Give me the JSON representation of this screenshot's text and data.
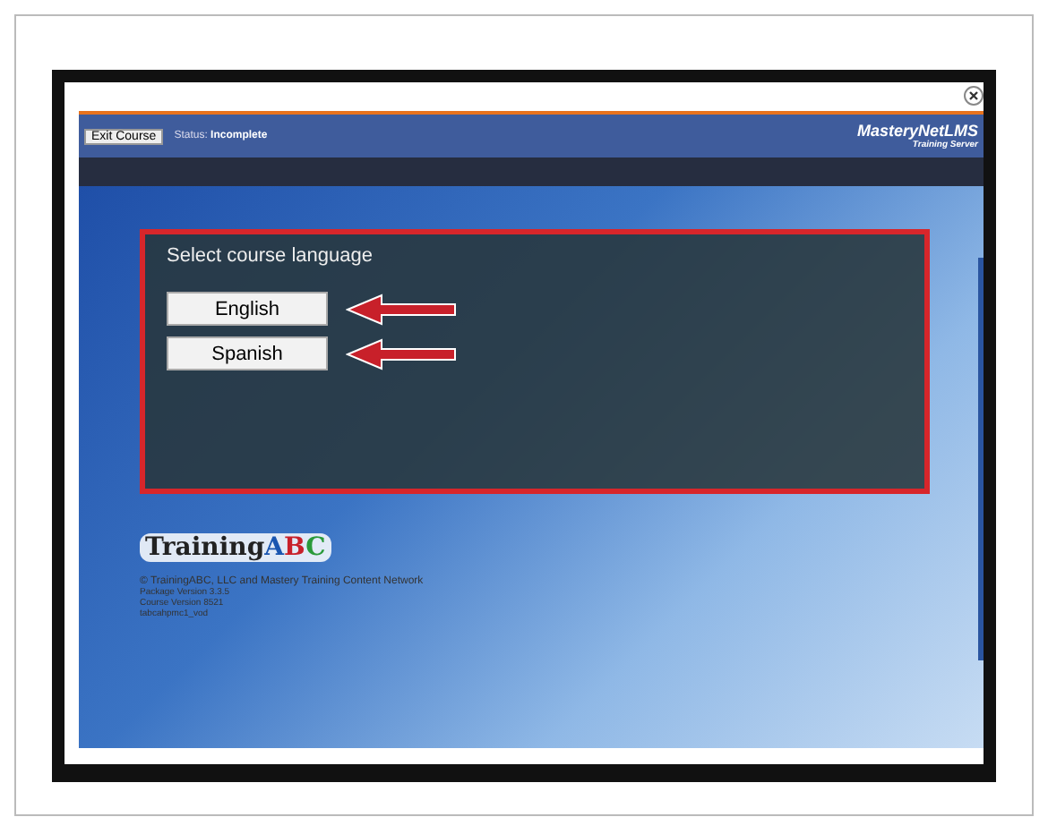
{
  "header": {
    "exit_button": "Exit Course",
    "status_label": "Status:",
    "status_value": "Incomplete",
    "brand_line1": "MasteryNetLMS",
    "brand_line2": "Training Server"
  },
  "dialog": {
    "title": "Select course language",
    "options": [
      {
        "label": "English",
        "pointed": true
      },
      {
        "label": "Spanish",
        "pointed": true
      }
    ]
  },
  "footer": {
    "logo_text": "Training",
    "logo_letters": [
      {
        "letter": "A",
        "color": "#1a56b0"
      },
      {
        "letter": "B",
        "color": "#c8202a"
      },
      {
        "letter": "C",
        "color": "#2a9a3a"
      }
    ],
    "lines": [
      "© TrainingABC, LLC and Mastery Training Content Network",
      "Package Version 3.3.5",
      "Course Version 8521",
      "tabcahpmc1_vod"
    ]
  }
}
